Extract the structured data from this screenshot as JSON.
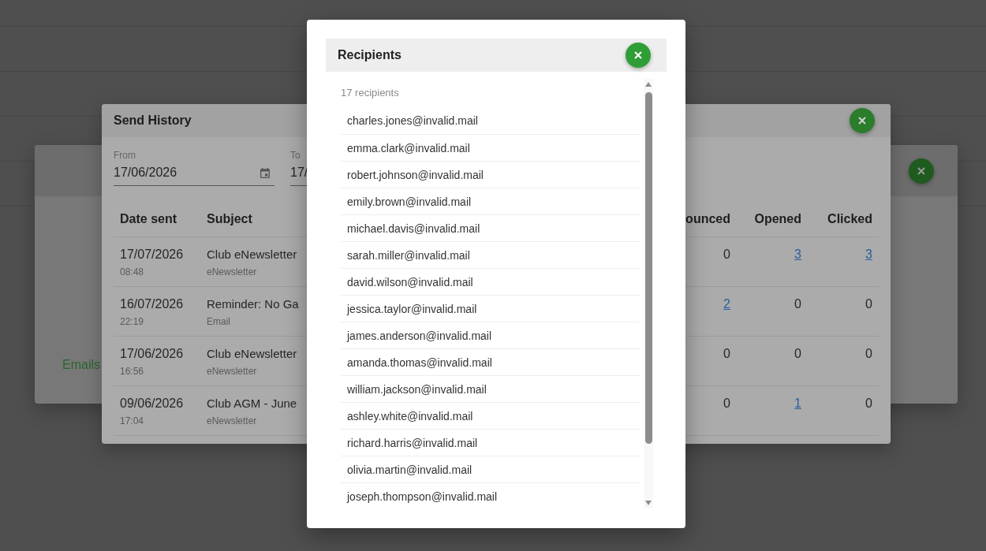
{
  "background_dialog": {
    "message": "Emails"
  },
  "send_history": {
    "title": "Send History",
    "filters": [
      {
        "label": "From",
        "value": "17/06/2026",
        "kind": "picker"
      },
      {
        "label": "To",
        "value": "17/",
        "kind": "partial"
      }
    ],
    "table": {
      "columns": [
        "Date sent",
        "Subject",
        "ounced",
        "Opened",
        "Clicked"
      ],
      "rows": [
        {
          "date": "17/07/2026",
          "time": "08:48",
          "subject": "Club eNewsletter",
          "type": "eNewsletter",
          "counts": [
            {
              "value": "0",
              "link": false
            },
            {
              "value": "3",
              "link": true
            },
            {
              "value": "3",
              "link": true
            }
          ]
        },
        {
          "date": "16/07/2026",
          "time": "22:19",
          "subject": "Reminder: No Ga",
          "type": "Email",
          "counts": [
            {
              "value": "2",
              "link": true
            },
            {
              "value": "0",
              "link": false
            },
            {
              "value": "0",
              "link": false
            }
          ]
        },
        {
          "date": "17/06/2026",
          "time": "16:56",
          "subject": "Club eNewsletter",
          "type": "eNewsletter",
          "counts": [
            {
              "value": "0",
              "link": false
            },
            {
              "value": "0",
              "link": false
            },
            {
              "value": "0",
              "link": false
            }
          ]
        },
        {
          "date": "09/06/2026",
          "time": "17:04",
          "subject": "Club AGM - June",
          "type": "eNewsletter",
          "counts": [
            {
              "value": "0",
              "link": false
            },
            {
              "value": "1",
              "link": true
            },
            {
              "value": "0",
              "link": false
            }
          ]
        }
      ]
    }
  },
  "recipients": {
    "title": "Recipients",
    "count": "17 recipients",
    "emails": [
      "charles.jones@invalid.mail",
      "emma.clark@invalid.mail",
      "robert.johnson@invalid.mail",
      "emily.brown@invalid.mail",
      "michael.davis@invalid.mail",
      "sarah.miller@invalid.mail",
      "david.wilson@invalid.mail",
      "jessica.taylor@invalid.mail",
      "james.anderson@invalid.mail",
      "amanda.thomas@invalid.mail",
      "william.jackson@invalid.mail",
      "ashley.white@invalid.mail",
      "richard.harris@invalid.mail",
      "olivia.martin@invalid.mail",
      "joseph.thompson@invalid.mail"
    ]
  }
}
